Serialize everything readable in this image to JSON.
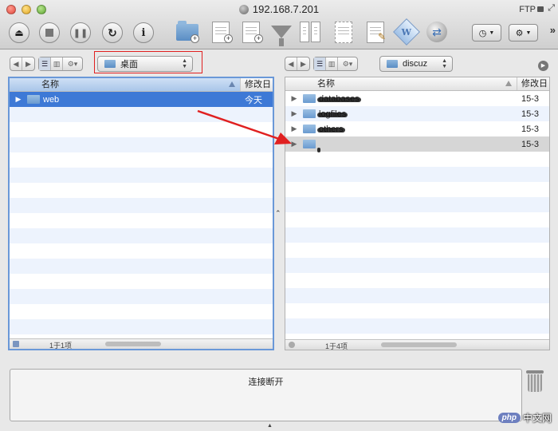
{
  "window": {
    "title": "192.168.7.201",
    "protocol": "FTP"
  },
  "toolbar": {
    "history_icon": "clock-icon",
    "action_icon": "gear-icon",
    "overflow": "»"
  },
  "left_pane": {
    "path": "桌面",
    "columns": {
      "name": "名称",
      "modified": "修改日"
    },
    "items": [
      {
        "name": "web",
        "modified": "今天",
        "selected": true
      }
    ],
    "status": "1于1项"
  },
  "right_pane": {
    "path": "discuz",
    "columns": {
      "name": "名称",
      "modified": "修改日"
    },
    "items": [
      {
        "name": "databases",
        "modified": "15-3",
        "redacted": true
      },
      {
        "name": "logfiles",
        "modified": "15-3",
        "redacted": true
      },
      {
        "name": "others",
        "modified": "15-3",
        "redacted": true
      },
      {
        "name": "",
        "modified": "15-3",
        "redacted": true,
        "highlighted": true
      }
    ],
    "status": "1于4项"
  },
  "transcript": {
    "text": "连接断开"
  },
  "watermark": {
    "logo": "php",
    "text": "中文网"
  },
  "colors": {
    "selection": "#3e79d6",
    "annotation_red": "#e02020",
    "stripe": "#edf3fd"
  }
}
